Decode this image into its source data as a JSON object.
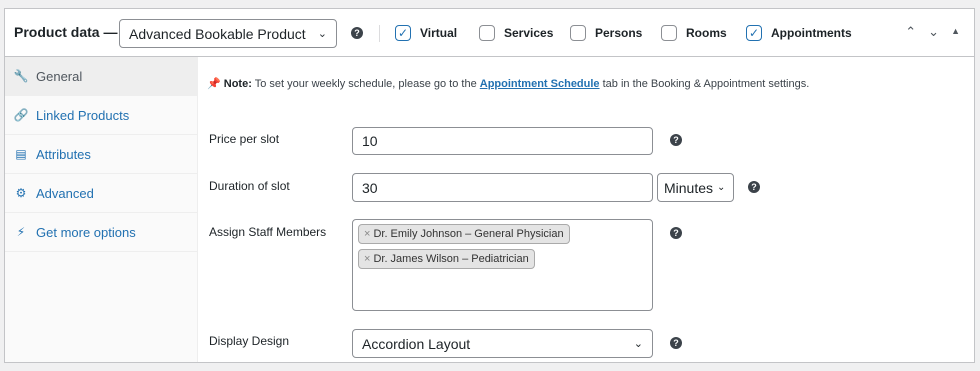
{
  "header": {
    "title": "Product data —",
    "product_type": "Advanced Bookable Product",
    "checkboxes": [
      {
        "label": "Virtual",
        "checked": true
      },
      {
        "label": "Services",
        "checked": false
      },
      {
        "label": "Persons",
        "checked": false
      },
      {
        "label": "Rooms",
        "checked": false
      },
      {
        "label": "Appointments",
        "checked": true
      }
    ],
    "help": "?"
  },
  "sidebar": {
    "items": [
      {
        "label": "General",
        "icon": "wrench-icon",
        "active": true
      },
      {
        "label": "Linked Products",
        "icon": "link-icon",
        "active": false
      },
      {
        "label": "Attributes",
        "icon": "list-icon",
        "active": false
      },
      {
        "label": "Advanced",
        "icon": "gear-icon",
        "active": false
      },
      {
        "label": "Get more options",
        "icon": "plugin-icon",
        "active": false
      }
    ]
  },
  "note": {
    "prefix": "Note:",
    "text_before": " To set your weekly schedule, please go to the ",
    "link": "Appointment Schedule",
    "text_after": " tab in the Booking & Appointment settings."
  },
  "fields": {
    "price_label": "Price per slot",
    "price_value": "10",
    "duration_label": "Duration of slot",
    "duration_value": "30",
    "duration_unit": "Minutes",
    "staff_label": "Assign Staff Members",
    "staff": [
      "Dr. Emily Johnson – General Physician",
      "Dr. James Wilson – Pediatrician"
    ],
    "design_label": "Display Design",
    "design_value": "Accordion Layout"
  },
  "colors": {
    "accent": "#2271b1",
    "pin": "#d63638"
  }
}
